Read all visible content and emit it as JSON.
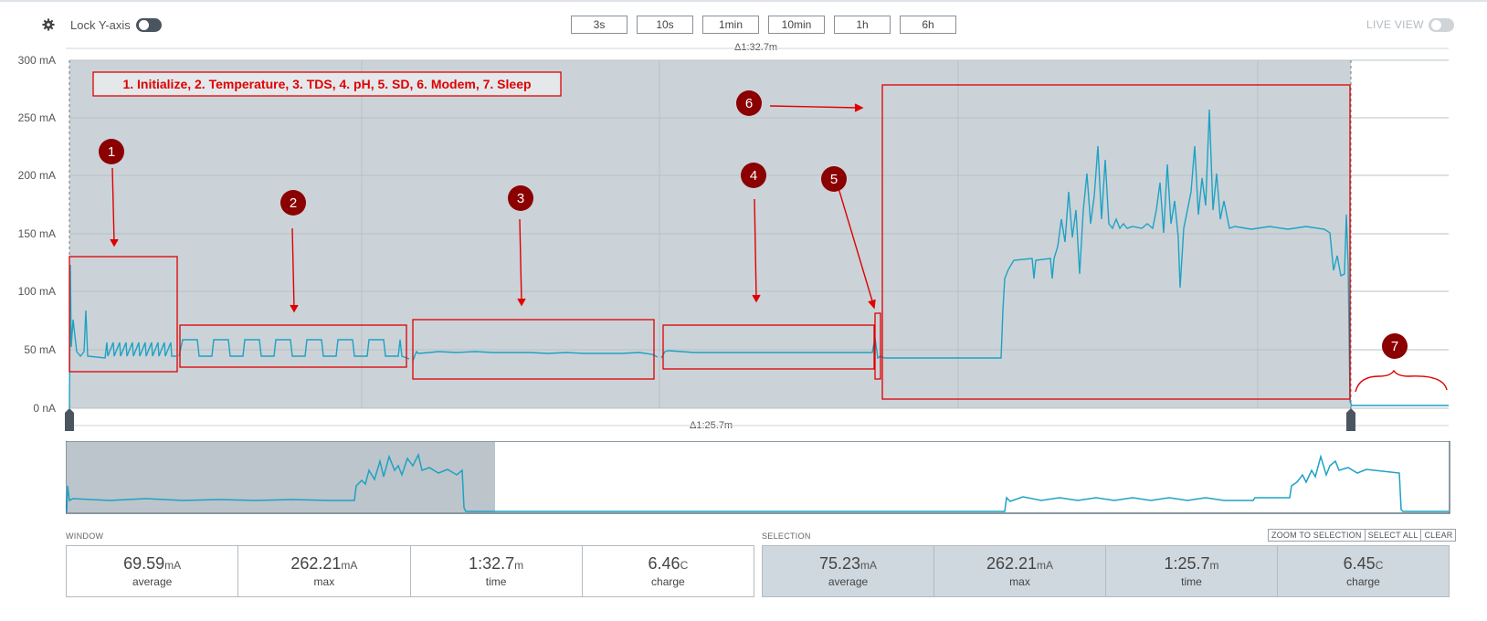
{
  "toolbar": {
    "lock_label": "Lock Y-axis",
    "lock_on": true,
    "windows": [
      "3s",
      "10s",
      "1min",
      "10min",
      "1h",
      "6h"
    ],
    "live_label": "LIVE VIEW",
    "live_on": false
  },
  "chart": {
    "y_ticks": [
      "300 mA",
      "250 mA",
      "200 mA",
      "150 mA",
      "100 mA",
      "50 mA",
      "0 nA"
    ],
    "delta_window": "Δ1:32.7m",
    "delta_selection": "Δ1:25.7m",
    "legend": "1. Initialize, 2. Temperature, 3. TDS, 4. pH, 5. SD, 6. Modem, 7. Sleep",
    "markers": [
      "1",
      "2",
      "3",
      "4",
      "5",
      "6",
      "7"
    ]
  },
  "colors": {
    "trace": "#1ea2c4",
    "annotation": "#e00000",
    "marker": "#8b0000",
    "selection": "#c9d1d6"
  },
  "stats": {
    "window": {
      "label": "WINDOW",
      "average": {
        "value": "69.59",
        "unit": "mA",
        "caption": "average"
      },
      "max": {
        "value": "262.21",
        "unit": "mA",
        "caption": "max"
      },
      "time": {
        "value": "1:32.7",
        "unit": "m",
        "caption": "time"
      },
      "charge": {
        "value": "6.46",
        "unit": "C",
        "caption": "charge"
      }
    },
    "selection": {
      "label": "SELECTION",
      "average": {
        "value": "75.23",
        "unit": "mA",
        "caption": "average"
      },
      "max": {
        "value": "262.21",
        "unit": "mA",
        "caption": "max"
      },
      "time": {
        "value": "1:25.7",
        "unit": "m",
        "caption": "time"
      },
      "charge": {
        "value": "6.45",
        "unit": "C",
        "caption": "charge"
      }
    },
    "buttons": {
      "zoom": "ZOOM TO SELECTION",
      "select_all": "SELECT ALL",
      "clear": "CLEAR"
    }
  }
}
